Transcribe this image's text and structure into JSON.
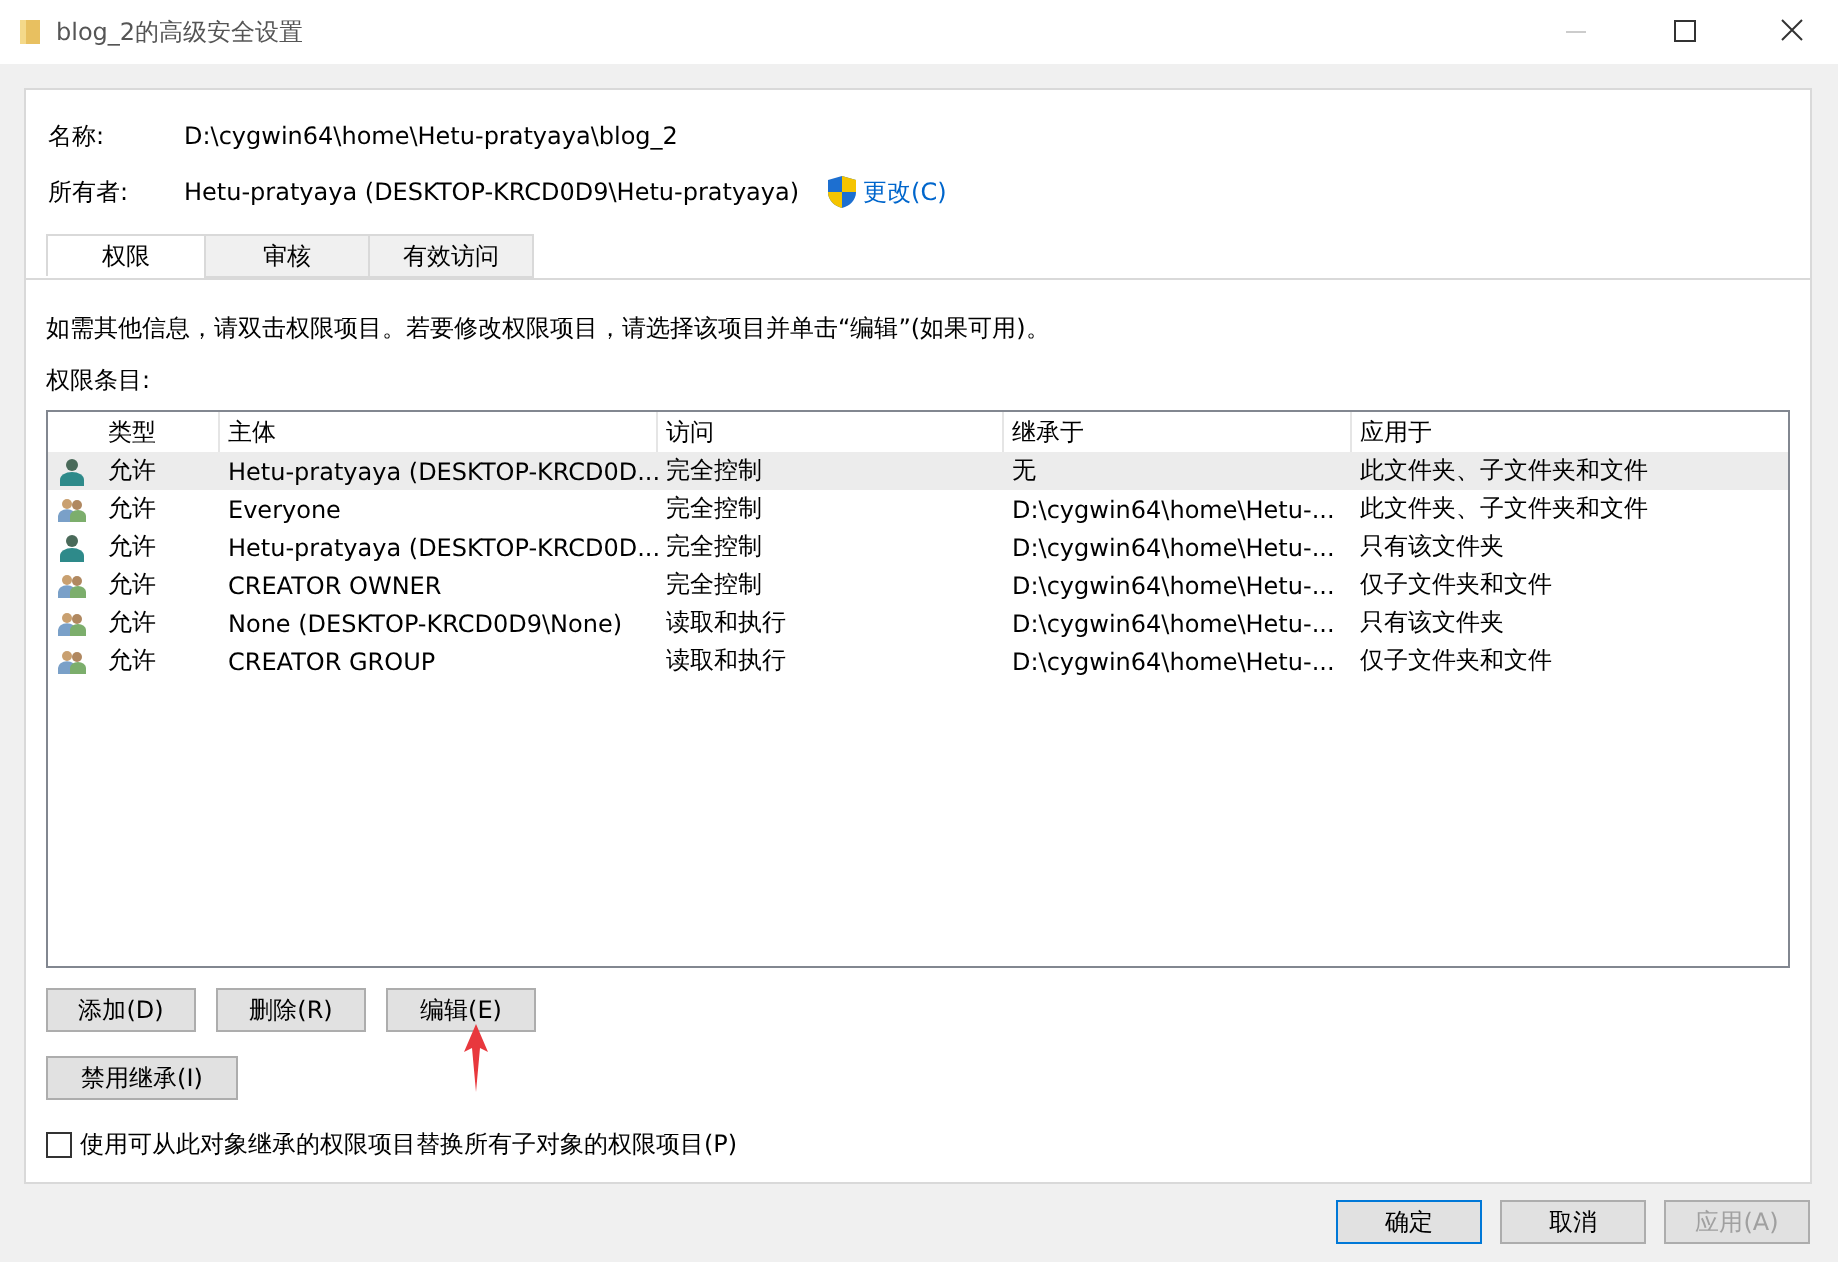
{
  "window": {
    "title": "blog_2的高级安全设置"
  },
  "name": {
    "label": "名称:",
    "value": "D:\\cygwin64\\home\\Hetu-pratyaya\\blog_2"
  },
  "owner": {
    "label": "所有者:",
    "value": "Hetu-pratyaya (DESKTOP-KRCD0D9\\Hetu-pratyaya)",
    "link": "更改(C)"
  },
  "tabs": [
    {
      "label": "权限",
      "selected": true
    },
    {
      "label": "审核",
      "selected": false
    },
    {
      "label": "有效访问",
      "selected": false
    }
  ],
  "info": "如需其他信息，请双击权限项目。若要修改权限项目，请选择该项目并单击“编辑”(如果可用)。",
  "list_label": "权限条目:",
  "table": {
    "columns": [
      "类型",
      "主体",
      "访问",
      "继承于",
      "应用于"
    ],
    "rows": [
      {
        "kind": "user",
        "selected": true,
        "cells": [
          "允许",
          "Hetu-pratyaya (DESKTOP-KRCD0D...",
          "完全控制",
          "无",
          "此文件夹、子文件夹和文件"
        ]
      },
      {
        "kind": "group",
        "selected": false,
        "cells": [
          "允许",
          "Everyone",
          "完全控制",
          "D:\\cygwin64\\home\\Hetu-...",
          "此文件夹、子文件夹和文件"
        ]
      },
      {
        "kind": "user",
        "selected": false,
        "cells": [
          "允许",
          "Hetu-pratyaya (DESKTOP-KRCD0D...",
          "完全控制",
          "D:\\cygwin64\\home\\Hetu-...",
          "只有该文件夹"
        ]
      },
      {
        "kind": "group",
        "selected": false,
        "cells": [
          "允许",
          "CREATOR OWNER",
          "完全控制",
          "D:\\cygwin64\\home\\Hetu-...",
          "仅子文件夹和文件"
        ]
      },
      {
        "kind": "group",
        "selected": false,
        "cells": [
          "允许",
          "None (DESKTOP-KRCD0D9\\None)",
          "读取和执行",
          "D:\\cygwin64\\home\\Hetu-...",
          "只有该文件夹"
        ]
      },
      {
        "kind": "group",
        "selected": false,
        "cells": [
          "允许",
          "CREATOR GROUP",
          "读取和执行",
          "D:\\cygwin64\\home\\Hetu-...",
          "仅子文件夹和文件"
        ]
      }
    ]
  },
  "entry_buttons": [
    {
      "label": "添加(D)"
    },
    {
      "label": "删除(R)"
    },
    {
      "label": "编辑(E)"
    }
  ],
  "inherit_button": {
    "label": "禁用继承(I)"
  },
  "replace_checkbox": {
    "label": "使用可从此对象继承的权限项目替换所有子对象的权限项目(P)",
    "checked": false
  },
  "dialog_buttons": [
    {
      "label": "确定",
      "default": true,
      "disabled": false
    },
    {
      "label": "取消",
      "default": false,
      "disabled": false
    },
    {
      "label": "应用(A)",
      "default": false,
      "disabled": true
    }
  ]
}
